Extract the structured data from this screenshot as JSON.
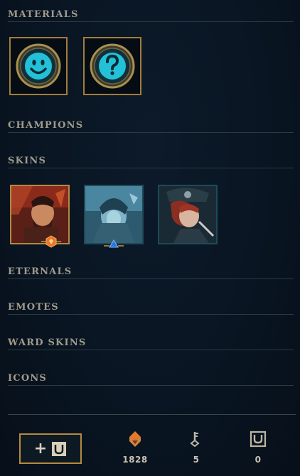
{
  "sections": {
    "materials": "MATERIALS",
    "champions": "CHAMPIONS",
    "skins": "SKINS",
    "eternals": "ETERNALS",
    "emotes": "EMOTES",
    "ward_skins": "WARD SKINS",
    "icons": "ICONS"
  },
  "materials": [
    {
      "icon": "smiley-emote-orb-icon"
    },
    {
      "icon": "question-mark-orb-icon"
    }
  ],
  "skins": [
    {
      "name": "skin-warrior",
      "frame": "gold",
      "badge": "orange-rarity-gem-icon"
    },
    {
      "name": "skin-ice",
      "frame": "teal",
      "badge": "blue-rarity-gem-icon"
    },
    {
      "name": "skin-pirate",
      "frame": "teal",
      "badge": null
    }
  ],
  "footer": {
    "add_button_icon": "add-loot-icon",
    "currencies": [
      {
        "icon": "orange-essence-icon",
        "amount": "1828"
      },
      {
        "icon": "key-icon",
        "amount": "5"
      },
      {
        "icon": "chest-icon",
        "amount": "0"
      }
    ]
  },
  "colors": {
    "gold": "#b58a41",
    "teal": "#1e4a58",
    "orb": "#22c1d8",
    "header_text": "#a09b8c",
    "orange_essence": "#e8782b"
  }
}
